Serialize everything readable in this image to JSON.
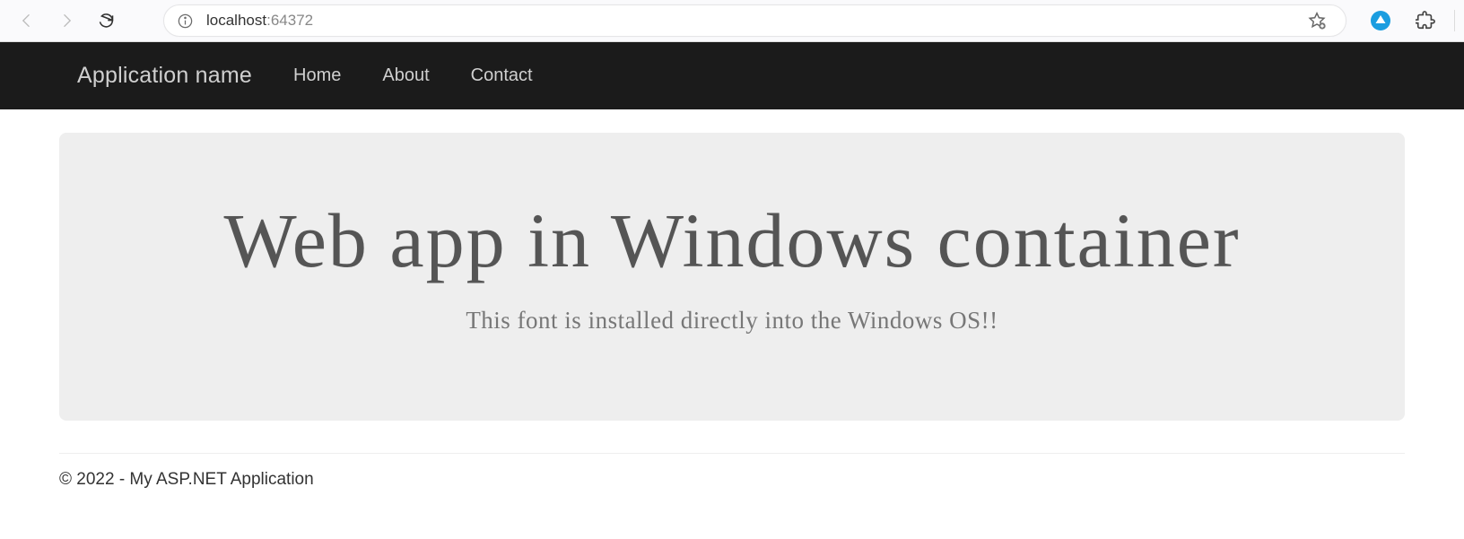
{
  "browser": {
    "url_host": "localhost",
    "url_port": ":64372"
  },
  "navbar": {
    "brand": "Application name",
    "links": {
      "home": "Home",
      "about": "About",
      "contact": "Contact"
    }
  },
  "hero": {
    "title": "Web app in Windows container",
    "subtitle": "This font is installed directly into the Windows OS!!"
  },
  "footer": {
    "text": "© 2022 - My ASP.NET Application"
  }
}
